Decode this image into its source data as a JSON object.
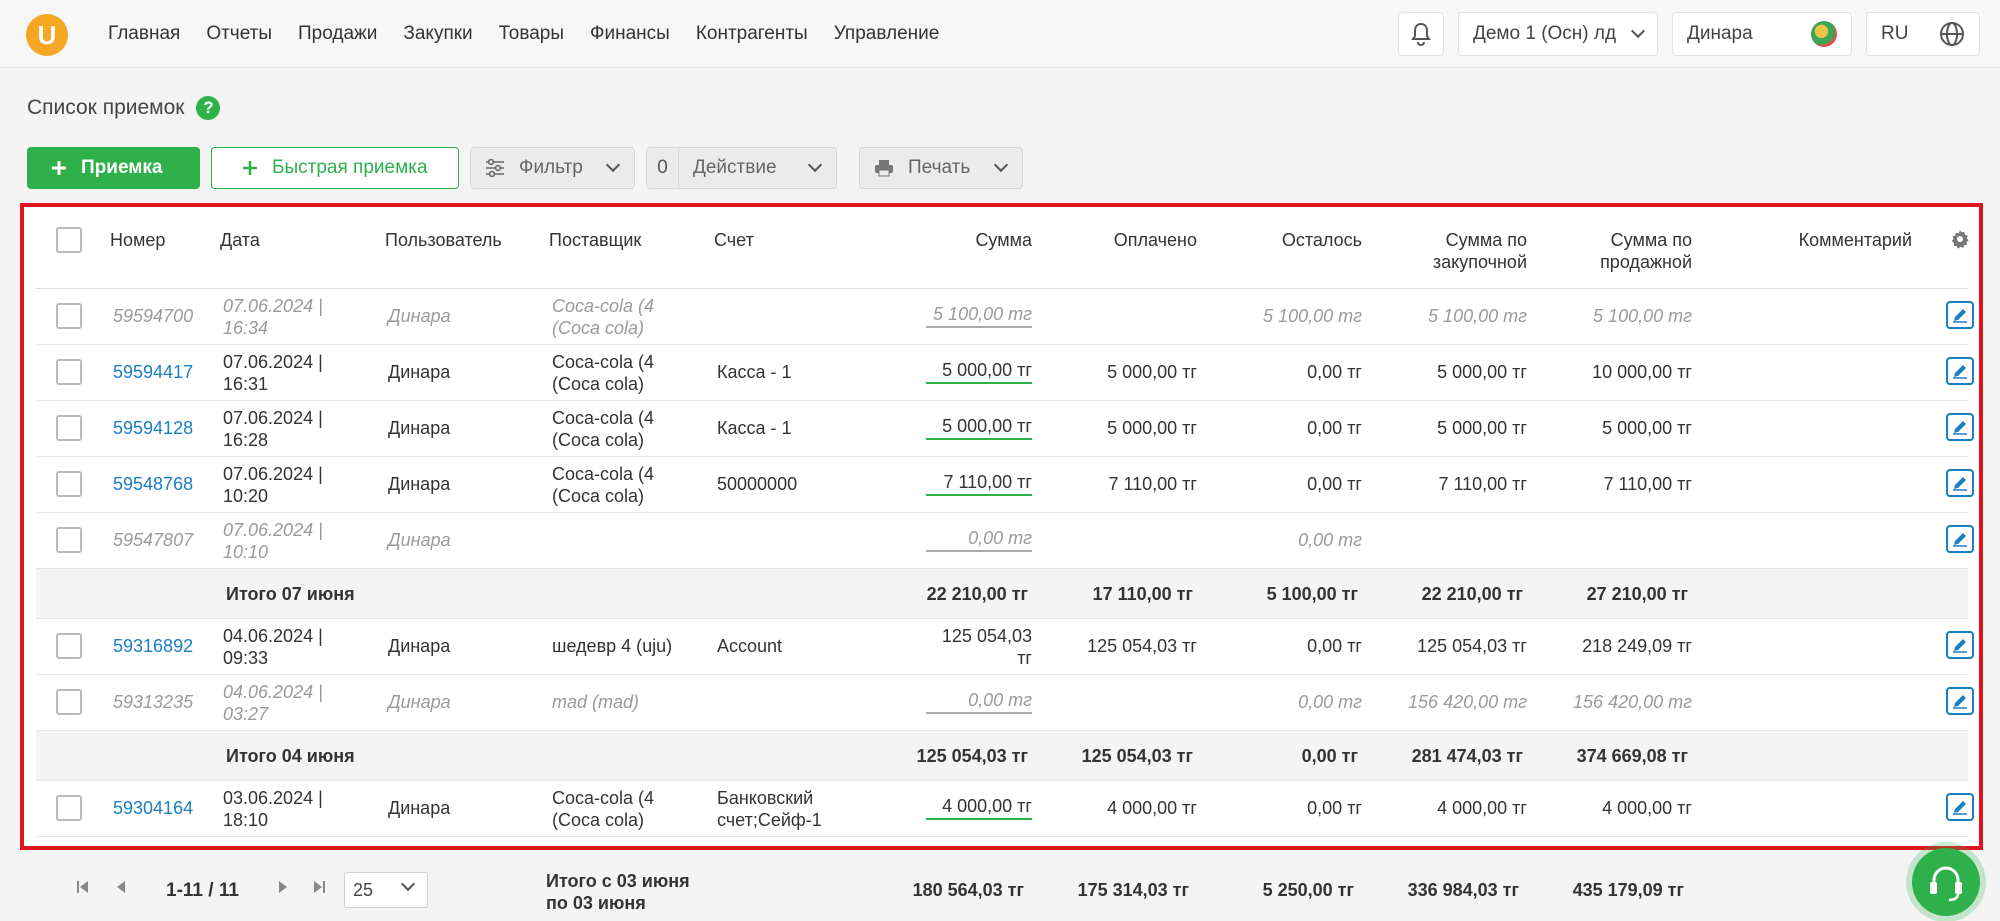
{
  "logo": "U",
  "nav": [
    "Главная",
    "Отчеты",
    "Продажи",
    "Закупки",
    "Товары",
    "Финансы",
    "Контрагенты",
    "Управление"
  ],
  "topbar": {
    "company": "Демо 1 (Осн) лд",
    "user": "Динара",
    "lang": "RU"
  },
  "page": {
    "title": "Список приемок",
    "help": "?"
  },
  "toolbar": {
    "add": "Приемка",
    "quick_add": "Быстрая приемка",
    "filter": "Фильтр",
    "action_count": "0",
    "action": "Действие",
    "print": "Печать"
  },
  "columns": {
    "number": "Номер",
    "date": "Дата",
    "user": "Пользователь",
    "supplier": "Поставщик",
    "account": "Счет",
    "sum": "Сумма",
    "paid": "Оплачено",
    "left": "Осталось",
    "sum_purchase_1": "Сумма по",
    "sum_purchase_2": "закупочной",
    "sum_sale_1": "Сумма по",
    "sum_sale_2": "продажной",
    "comment": "Комментарий"
  },
  "rows": [
    {
      "number": "59594700",
      "date1": "07.06.2024 |",
      "date2": "16:34",
      "user": "Динара",
      "supplier1": "Coca-cola (4",
      "supplier2": "(Coca cola)",
      "account1": "",
      "account2": "",
      "sum": "5 100,00 тг",
      "paid": "",
      "left": "5 100,00 тг",
      "purchase": "5 100,00 тг",
      "sale": "5 100,00 тг"
    },
    {
      "number": "59594417",
      "date1": "07.06.2024 |",
      "date2": "16:31",
      "user": "Динара",
      "supplier1": "Coca-cola (4",
      "supplier2": "(Coca cola)",
      "account1": "Касса - 1",
      "account2": "",
      "sum": "5 000,00 тг",
      "paid": "5 000,00 тг",
      "left": "0,00 тг",
      "purchase": "5 000,00 тг",
      "sale": "10 000,00 тг"
    },
    {
      "number": "59594128",
      "date1": "07.06.2024 |",
      "date2": "16:28",
      "user": "Динара",
      "supplier1": "Coca-cola (4",
      "supplier2": "(Coca cola)",
      "account1": "Касса - 1",
      "account2": "",
      "sum": "5 000,00 тг",
      "paid": "5 000,00 тг",
      "left": "0,00 тг",
      "purchase": "5 000,00 тг",
      "sale": "5 000,00 тг"
    },
    {
      "number": "59548768",
      "date1": "07.06.2024 |",
      "date2": "10:20",
      "user": "Динара",
      "supplier1": "Coca-cola (4",
      "supplier2": "(Coca cola)",
      "account1": "50000000",
      "account2": "",
      "sum": "7 110,00 тг",
      "paid": "7 110,00 тг",
      "left": "0,00 тг",
      "purchase": "7 110,00 тг",
      "sale": "7 110,00 тг"
    },
    {
      "number": "59547807",
      "date1": "07.06.2024 |",
      "date2": "10:10",
      "user": "Динара",
      "supplier1": "",
      "supplier2": "",
      "account1": "",
      "account2": "",
      "sum": "0,00 тг",
      "paid": "",
      "left": "0,00 тг",
      "purchase": "",
      "sale": ""
    },
    {
      "number": "59316892",
      "date1": "04.06.2024 |",
      "date2": "09:33",
      "user": "Динара",
      "supplier1": "шедевр 4 (uju)",
      "supplier2": "",
      "account1": "Account",
      "account2": "",
      "sum": "125 054,03",
      "sum2": "тг",
      "paid": "125 054,03 тг",
      "left": "0,00 тг",
      "purchase": "125 054,03 тг",
      "sale": "218 249,09 тг"
    },
    {
      "number": "59313235",
      "date1": "04.06.2024 |",
      "date2": "03:27",
      "user": "Динара",
      "supplier1": "mad (mad)",
      "supplier2": "",
      "account1": "",
      "account2": "",
      "sum": "0,00 тг",
      "paid": "",
      "left": "0,00 тг",
      "purchase": "156 420,00 тг",
      "sale": "156 420,00 тг"
    },
    {
      "number": "59304164",
      "date1": "03.06.2024 |",
      "date2": "18:10",
      "user": "Динара",
      "supplier1": "Coca-cola (4",
      "supplier2": "(Coca cola)",
      "account1": "Банковский",
      "account2": "счет;Сейф-1",
      "sum": "4 000,00 тг",
      "paid": "4 000,00 тг",
      "left": "0,00 тг",
      "purchase": "4 000,00 тг",
      "sale": "4 000,00 тг"
    }
  ],
  "totals": [
    {
      "label": "Итого 07 июня",
      "sum": "22 210,00 тг",
      "paid": "17 110,00 тг",
      "left": "5 100,00 тг",
      "purchase": "22 210,00 тг",
      "sale": "27 210,00 тг"
    },
    {
      "label": "Итого 04 июня",
      "sum": "125 054,03 тг",
      "paid": "125 054,03 тг",
      "left": "0,00 тг",
      "purchase": "281 474,03 тг",
      "sale": "374 669,08 тг"
    }
  ],
  "footer": {
    "range": "1-11 / 11",
    "per_page": "25",
    "label1": "Итого с 03 июня",
    "label2": "по 03 июня",
    "sum": "180 564,03 тг",
    "paid": "175 314,03 тг",
    "left": "5 250,00 тг",
    "purchase": "336 984,03 тг",
    "sale": "435 179,09 тг"
  },
  "colors": {
    "accent": "#2eb04b",
    "link": "#1a7ec4",
    "highlight": "#e0141e"
  }
}
